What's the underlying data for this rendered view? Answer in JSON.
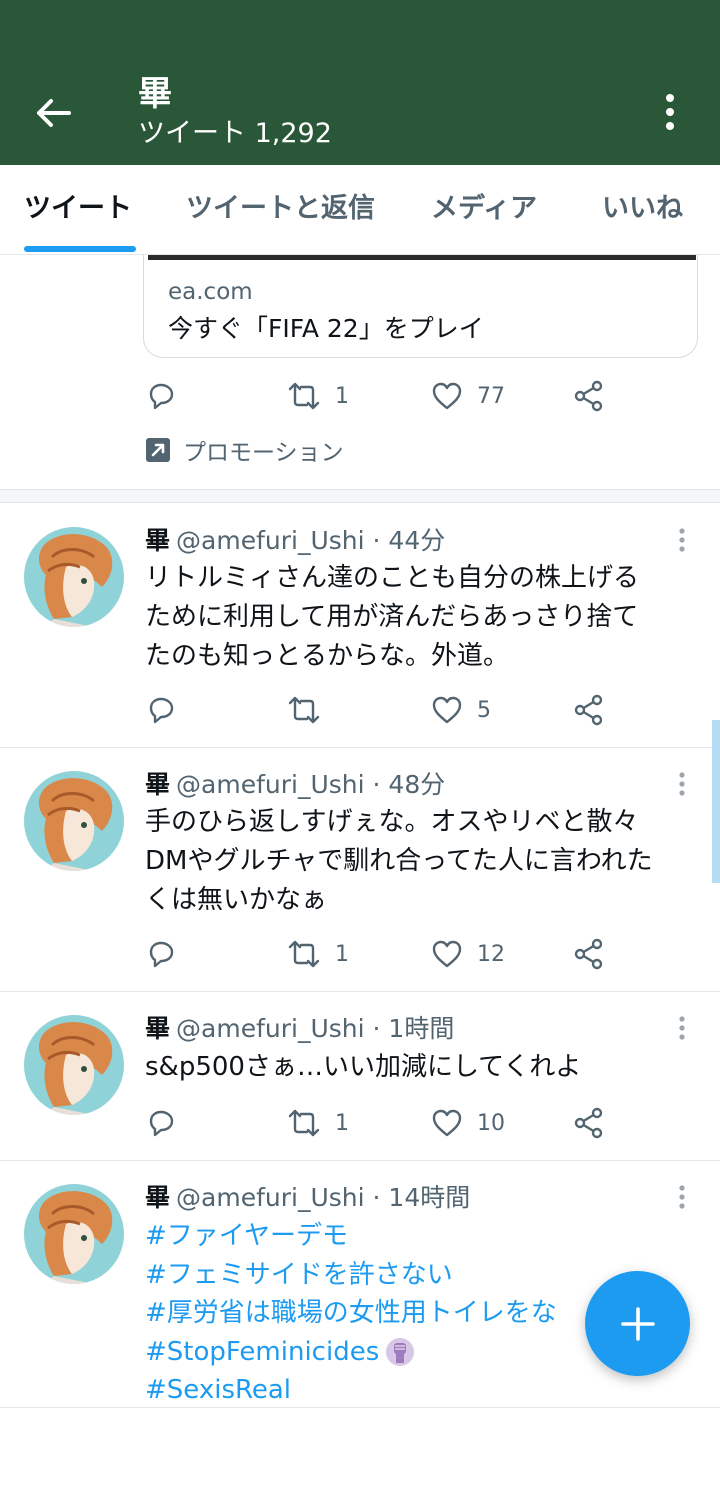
{
  "header": {
    "title": "畢",
    "subtitle": "ツイート 1,292",
    "bg_color": "#2a5738"
  },
  "tabs": [
    {
      "label": "ツイート",
      "active": true
    },
    {
      "label": "ツイートと返信",
      "active": false
    },
    {
      "label": "メディア",
      "active": false
    },
    {
      "label": "いいね",
      "active": false
    }
  ],
  "promo": {
    "domain": "ea.com",
    "title": "今すぐ「FIFA 22」をプレイ",
    "retweets": "1",
    "likes": "77",
    "label": "プロモーション"
  },
  "tweets": [
    {
      "name": "畢",
      "handle": "@amefuri_Ushi",
      "time": "· 44分",
      "lines": [
        "リトルミィさん達のことも自分の株上げる",
        "ために利用して用が済んだらあっさり捨て",
        "たのも知っとるからな。外道。"
      ],
      "retweets": "",
      "likes": "5"
    },
    {
      "name": "畢",
      "handle": "@amefuri_Ushi",
      "time": "· 48分",
      "lines": [
        "手のひら返しすげぇな。オスやリベと散々",
        "DMやグルチャで馴れ合ってた人に言われた",
        "くは無いかなぁ"
      ],
      "retweets": "1",
      "likes": "12"
    },
    {
      "name": "畢",
      "handle": "@amefuri_Ushi",
      "time": "· 1時間",
      "lines": [
        "s&p500さぁ…いい加減にしてくれよ"
      ],
      "retweets": "1",
      "likes": "10"
    },
    {
      "name": "畢",
      "handle": "@amefuri_Ushi",
      "time": "· 14時間",
      "hashtags": [
        "#ファイヤーデモ",
        "#フェミサイドを許さない",
        "#厚労省は職場の女性用トイレをな",
        "#StopFeminicides",
        "#SexisReal"
      ]
    }
  ],
  "colors": {
    "accent": "#1d9bf0",
    "secondary_text": "#536471"
  }
}
